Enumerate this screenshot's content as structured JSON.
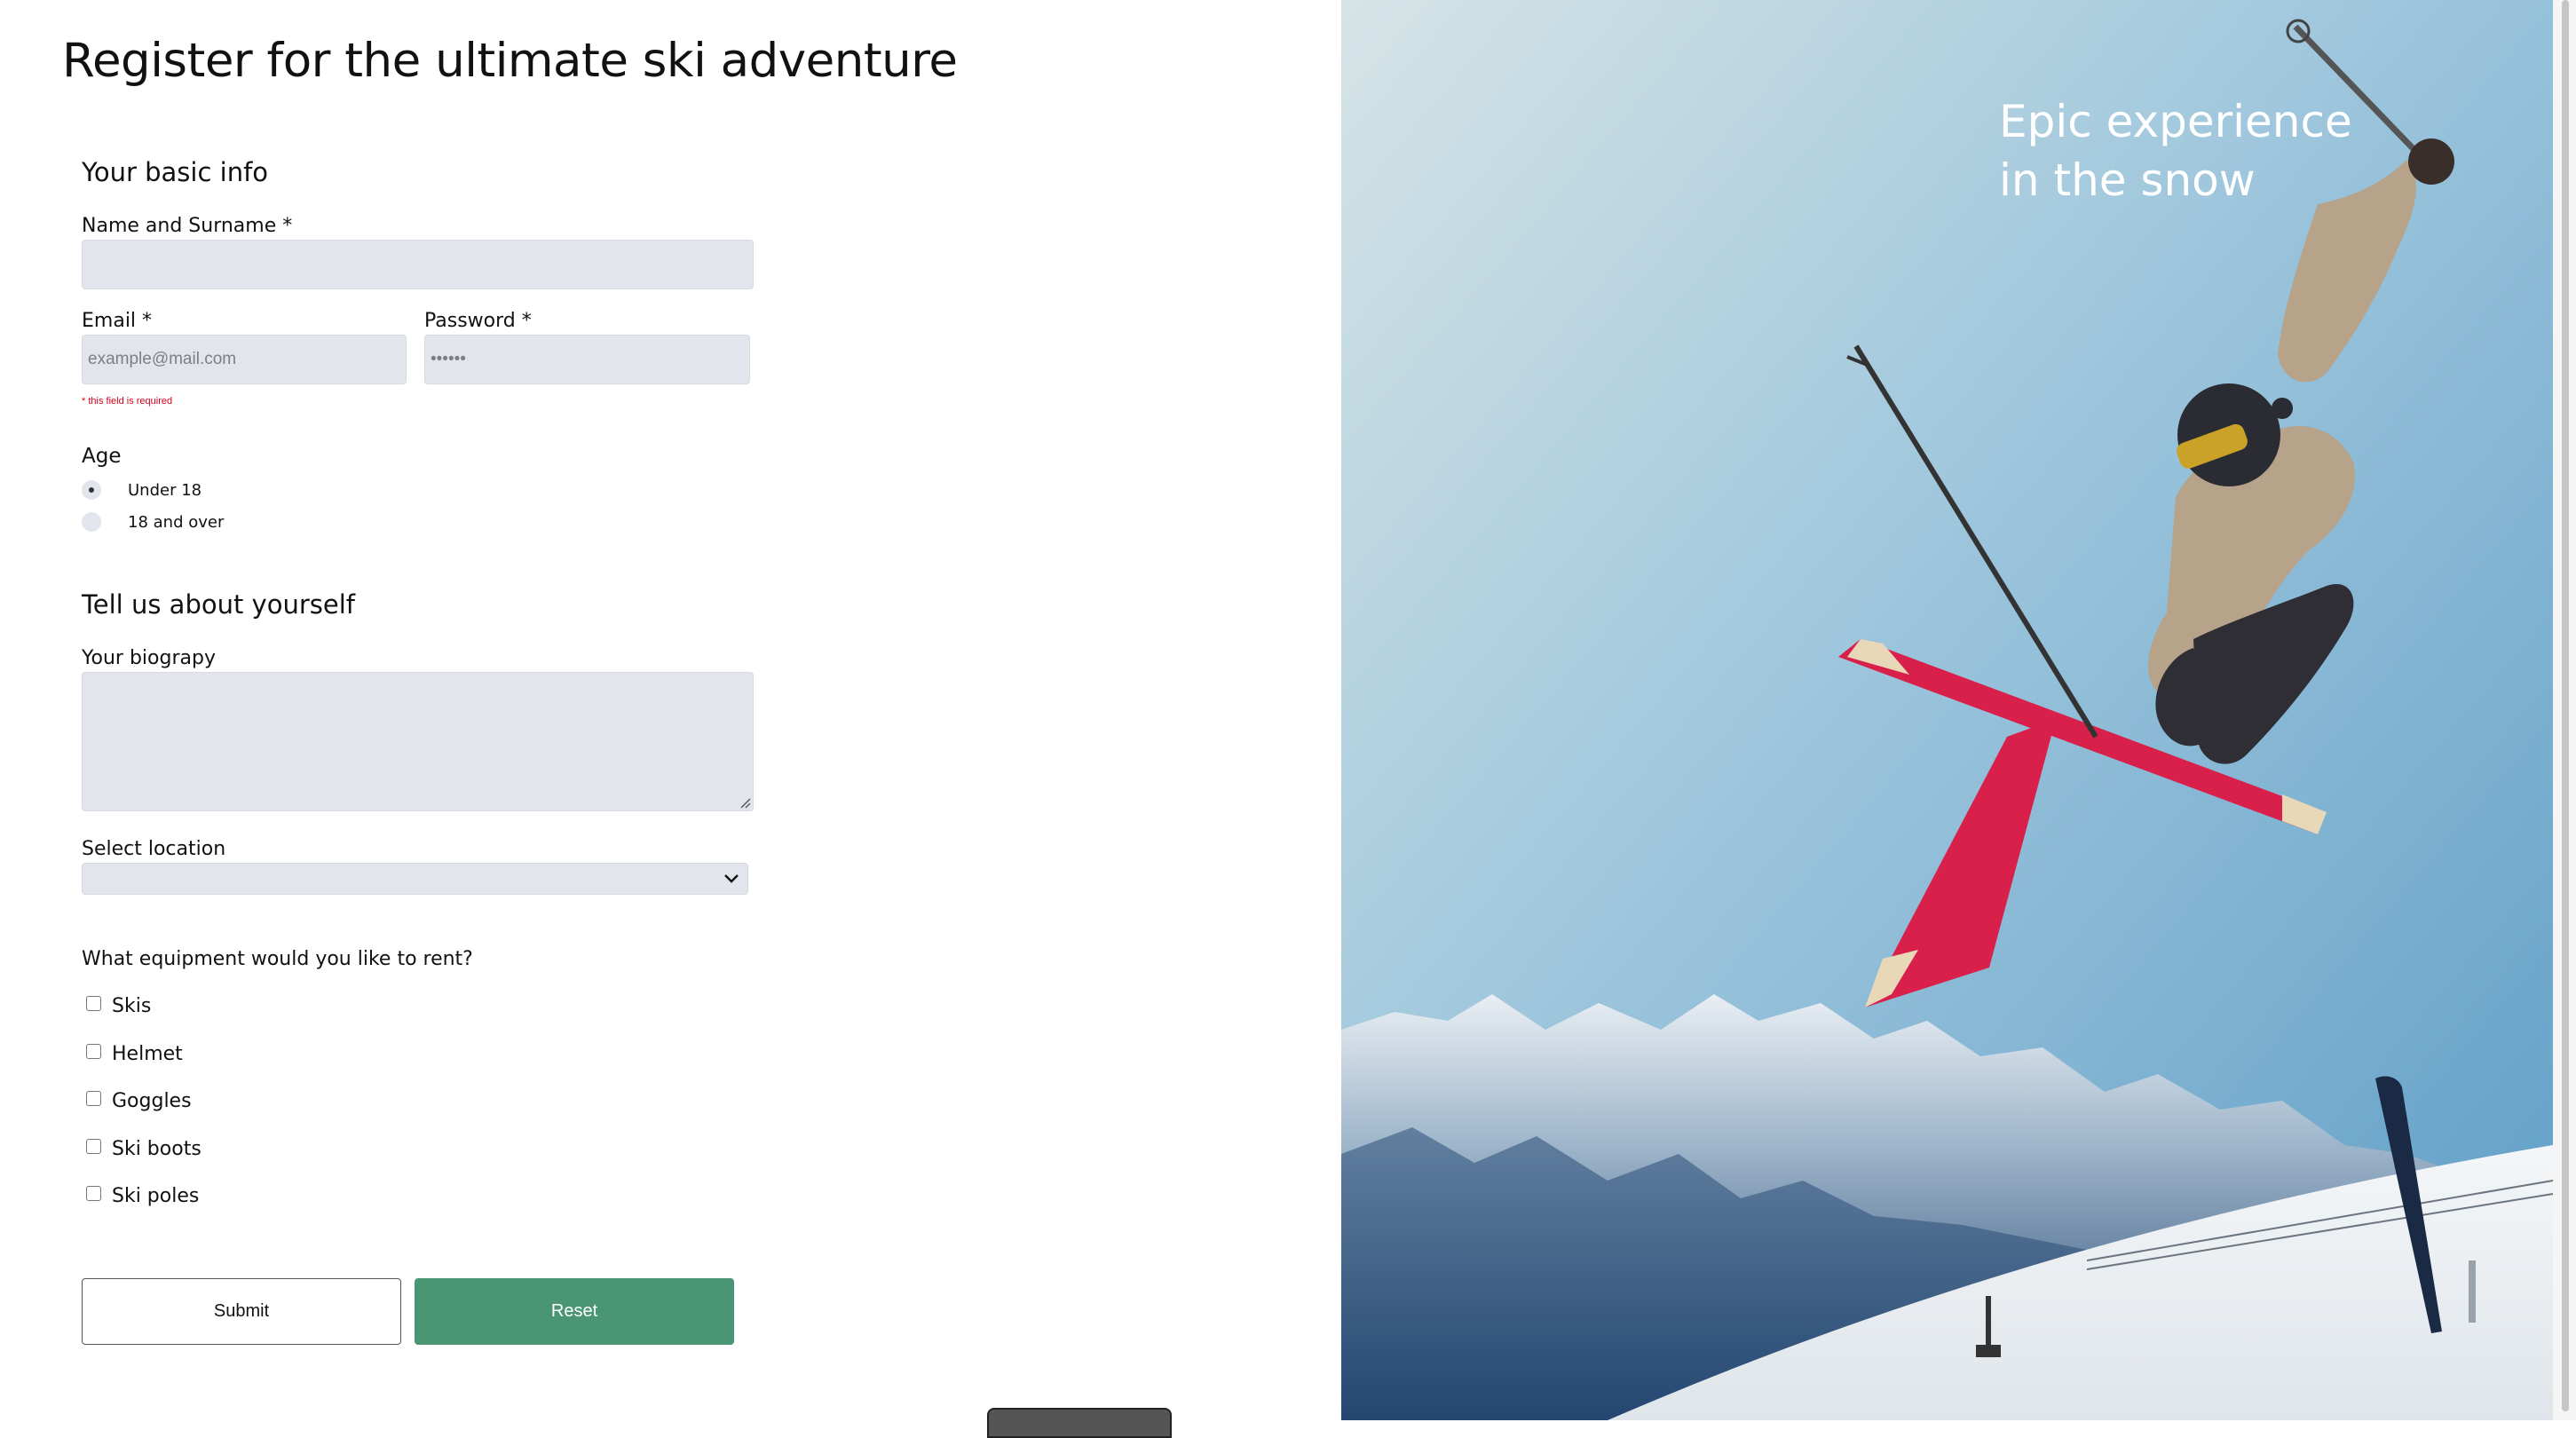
{
  "form": {
    "title": "Register for the ultimate ski adventure",
    "basic_info": {
      "heading": "Your basic info",
      "name_label": "Name and Surname *",
      "name_value": "",
      "email_label": "Email *",
      "email_placeholder": "example@mail.com",
      "email_error": "* this field is required",
      "password_label": "Password *",
      "password_placeholder": "••••••"
    },
    "age": {
      "label": "Age",
      "options": [
        {
          "label": "Under 18",
          "selected": true
        },
        {
          "label": "18 and over",
          "selected": false
        }
      ]
    },
    "about": {
      "heading": "Tell us about yourself",
      "bio_label": "Your biograpy",
      "bio_value": "",
      "location_label": "Select location",
      "location_value": ""
    },
    "equipment": {
      "question": "What equipment would you like to rent?",
      "items": [
        {
          "label": "Skis",
          "checked": false
        },
        {
          "label": "Helmet",
          "checked": false
        },
        {
          "label": "Goggles",
          "checked": false
        },
        {
          "label": "Ski boots",
          "checked": false
        },
        {
          "label": "Ski poles",
          "checked": false
        }
      ]
    },
    "buttons": {
      "submit": "Submit",
      "reset": "Reset"
    }
  },
  "hero": {
    "line1": "Epic experience",
    "line2": "in the snow",
    "image_subject": "freestyle skier mid-jump with red skis above snowy mountains"
  },
  "colors": {
    "field_bg": "#e2e5ec",
    "reset_bg": "#4a9574",
    "error": "#d0021b",
    "sky": "#8fbfd9",
    "ski_red": "#d8204a"
  }
}
